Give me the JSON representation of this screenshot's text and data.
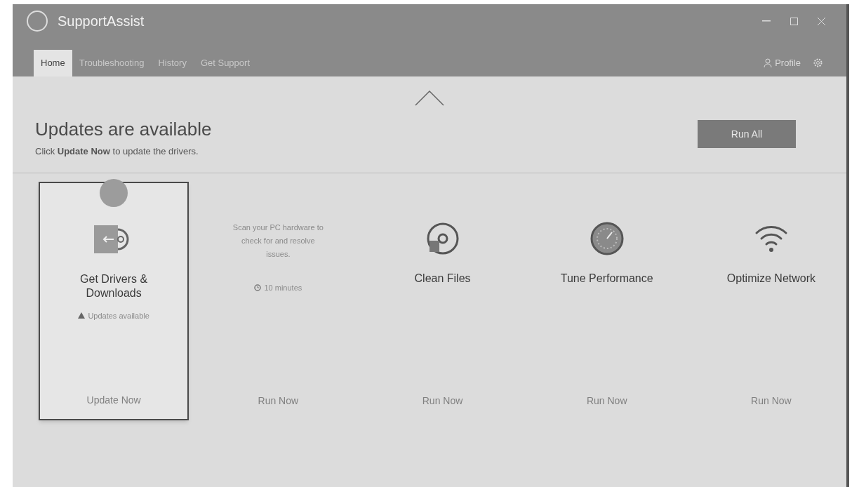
{
  "window": {
    "title": "SupportAssist"
  },
  "tabs": [
    {
      "label": "Home",
      "selected": true
    },
    {
      "label": "Troubleshooting",
      "selected": false
    },
    {
      "label": "History",
      "selected": false
    },
    {
      "label": "Get Support",
      "selected": false
    }
  ],
  "profile": {
    "label": "Profile"
  },
  "banner": {
    "title": "Updates are available",
    "subtitle": "Click **Update Now** to update the drivers.",
    "button": "Run All"
  },
  "cards": [
    {
      "kind": "drivers",
      "selected": true,
      "title": "Get Drivers & Downloads",
      "status": "Updates available",
      "action": "Update Now"
    },
    {
      "kind": "scan",
      "selected": false,
      "description": "Scan your PC hardware to check for and resolve issues.",
      "duration": "10 minutes",
      "action": "Run Now"
    },
    {
      "kind": "clean",
      "selected": false,
      "title": "Clean Files",
      "action": "Run Now"
    },
    {
      "kind": "tune",
      "selected": false,
      "title": "Tune Performance",
      "action": "Run Now"
    },
    {
      "kind": "network",
      "selected": false,
      "title": "Optimize Network",
      "action": "Run Now"
    }
  ]
}
